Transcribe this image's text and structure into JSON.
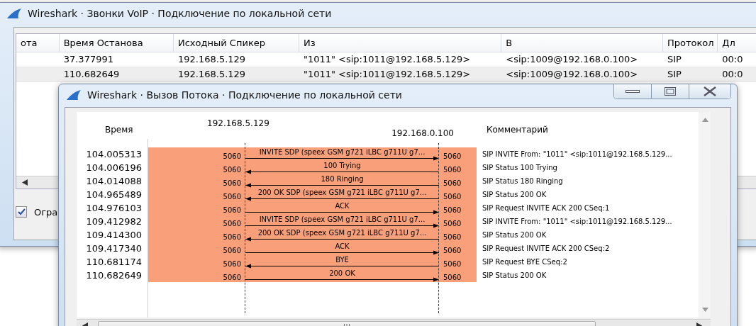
{
  "back_window": {
    "title": "Wireshark · Звонки VoIP · Подключение по локальной сети",
    "table": {
      "columns": [
        "ота",
        "Время Останова",
        "Исходный Спикер",
        "Из",
        "В",
        "Протокол",
        "Дл"
      ],
      "rows": [
        {
          "selected": false,
          "cells": [
            "",
            "37.377991",
            "192.168.5.129",
            "\"1011\" <sip:1011@192.168.5.129>",
            "<sip:1009@192.168.0.100>",
            "SIP",
            "00:0"
          ]
        },
        {
          "selected": true,
          "cells": [
            "",
            "110.682649",
            "192.168.5.129",
            "\"1011\" <sip:1011@192.168.5.129>",
            "<sip:1009@192.168.0.100>",
            "SIP",
            "00:0"
          ]
        }
      ]
    },
    "checkbox": {
      "label": "Огра",
      "checked": true
    }
  },
  "flow_window": {
    "title": "Wireshark · Вызов Потока · Подключение по локальной сети",
    "time_header": "Время",
    "hosts": [
      "192.168.5.129",
      "192.168.0.100"
    ],
    "comment_header": "Комментарий",
    "messages": [
      {
        "time": "104.005313",
        "src_port": "5060",
        "dst_port": "5060",
        "label": "INVITE SDP (speex GSM g721 iLBC g711U g7...",
        "kind": "rightward",
        "comment": "SIP INVITE From: \"1011\" <sip:1011@192.168.5.129..."
      },
      {
        "time": "104.006196",
        "src_port": "5060",
        "dst_port": "5060",
        "label": "100 Trying",
        "kind": "leftward",
        "comment": "SIP Status 100 Trying"
      },
      {
        "time": "104.014088",
        "src_port": "5060",
        "dst_port": "5060",
        "label": "180 Ringing",
        "kind": "leftward",
        "comment": "SIP Status 180 Ringing"
      },
      {
        "time": "104.965489",
        "src_port": "5060",
        "dst_port": "5060",
        "label": "200 OK SDP (speex GSM g721 iLBC g711U g7...",
        "kind": "leftward",
        "comment": "SIP Status 200 OK"
      },
      {
        "time": "104.976103",
        "src_port": "5060",
        "dst_port": "5060",
        "label": "ACK",
        "kind": "rightward",
        "comment": "SIP Request INVITE ACK 200 CSeq:1"
      },
      {
        "time": "109.412982",
        "src_port": "5060",
        "dst_port": "5060",
        "label": "INVITE SDP (speex GSM g721 iLBC g711U g7...",
        "kind": "rightward",
        "comment": "SIP INVITE From: \"1011\" <sip:1011@192.168.5.129..."
      },
      {
        "time": "109.414300",
        "src_port": "5060",
        "dst_port": "5060",
        "label": "200 OK SDP (speex GSM g721 iLBC g711U g7...",
        "kind": "leftward",
        "comment": "SIP Status 200 OK"
      },
      {
        "time": "109.417340",
        "src_port": "5060",
        "dst_port": "5060",
        "label": "ACK",
        "kind": "rightward",
        "comment": "SIP Request INVITE ACK 200 CSeq:2"
      },
      {
        "time": "110.681174",
        "src_port": "5060",
        "dst_port": "5060",
        "label": "BYE",
        "kind": "leftward",
        "comment": "SIP Request BYE CSeq:2"
      },
      {
        "time": "110.682649",
        "src_port": "5060",
        "dst_port": "5060",
        "label": "200 OK",
        "kind": "rightward",
        "comment": "SIP Status 200 OK"
      }
    ]
  }
}
